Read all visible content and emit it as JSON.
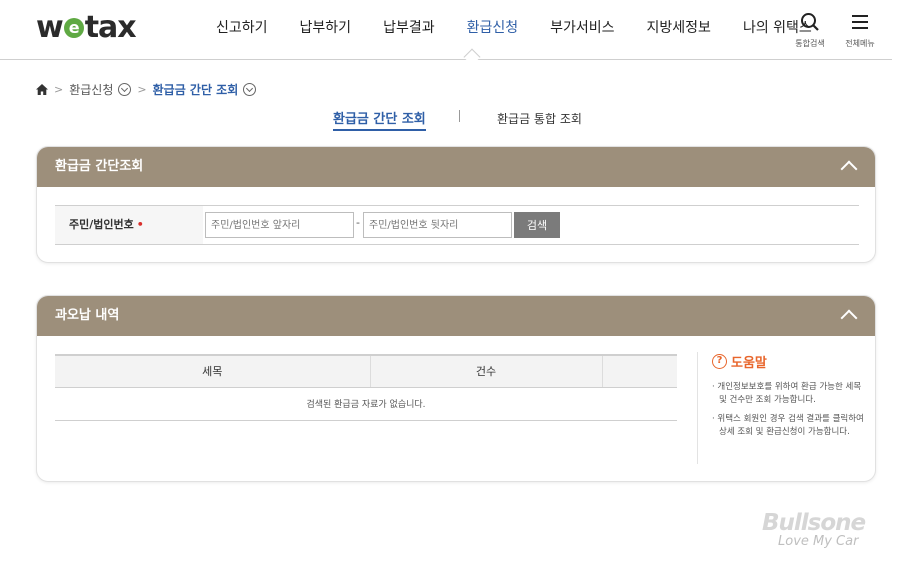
{
  "header": {
    "logo_text_start": "w",
    "logo_text_e": "e",
    "logo_text_end": "tax",
    "nav": [
      {
        "label": "신고하기"
      },
      {
        "label": "납부하기"
      },
      {
        "label": "납부결과"
      },
      {
        "label": "환급신청"
      },
      {
        "label": "부가서비스"
      },
      {
        "label": "지방세정보"
      },
      {
        "label": "나의 위택스"
      }
    ],
    "active_nav": "환급신청",
    "search_label": "통합검색",
    "menu_label": "전체메뉴"
  },
  "breadcrumb": {
    "level1": "환급신청",
    "current": "환급금 간단 조회"
  },
  "subtabs": {
    "active": "환급금 간단 조회",
    "other": "환급금 통합 조회"
  },
  "lookup_panel": {
    "title": "환급금 간단조회",
    "id_label": "주민/법인번호",
    "required_mark": "•",
    "front_placeholder": "주민/법인번호 앞자리",
    "dash": "-",
    "back_placeholder": "주민/법인번호 뒷자리",
    "search_button": "검색"
  },
  "result_panel": {
    "title": "과오납 내역",
    "columns": [
      "세목",
      "건수",
      ""
    ],
    "empty_message": "검색된 환급금 자료가 없습니다."
  },
  "help": {
    "title": "도움말",
    "items": [
      "개인정보보호를 위하여 환급 가능한 세목 및 건수만 조회 가능합니다.",
      "위택스 회원인 경우 검색 결과를 클릭하여 상세 조회 및 환급신청이 가능합니다."
    ]
  },
  "watermark": {
    "brand": "Bullsone",
    "slogan": "Love My Car"
  },
  "colors": {
    "accent_blue": "#2f5fa7",
    "panel_header": "#9d8f7b",
    "help_orange": "#e8662c",
    "required_red": "#d9302c",
    "logo_green": "#5fa943"
  }
}
